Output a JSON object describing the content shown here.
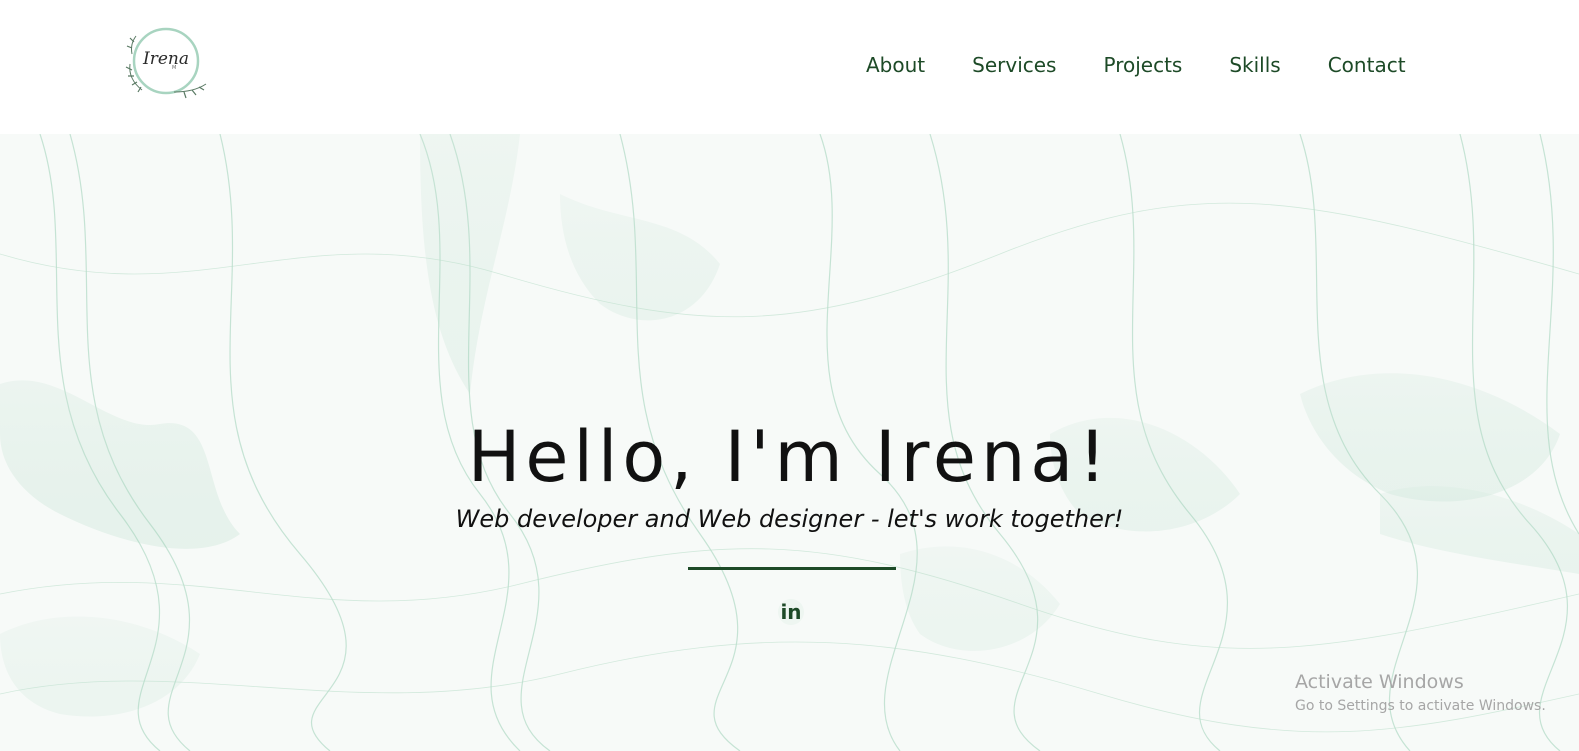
{
  "header": {
    "logo": {
      "name": "Irena",
      "initials": "M"
    },
    "nav": [
      {
        "label": "About"
      },
      {
        "label": "Services"
      },
      {
        "label": "Projects"
      },
      {
        "label": "Skills"
      },
      {
        "label": "Contact"
      }
    ]
  },
  "hero": {
    "title": "Hello, I'm Irena!",
    "subtitle": "Web developer and Web designer - let's work together!",
    "social": {
      "linkedin_label": "in"
    }
  },
  "os_watermark": {
    "title": "Activate Windows",
    "subtitle": "Go to Settings to activate Windows."
  },
  "colors": {
    "accent": "#1d4a27",
    "text": "#111111",
    "hero_tint": "#9ccfb6"
  }
}
